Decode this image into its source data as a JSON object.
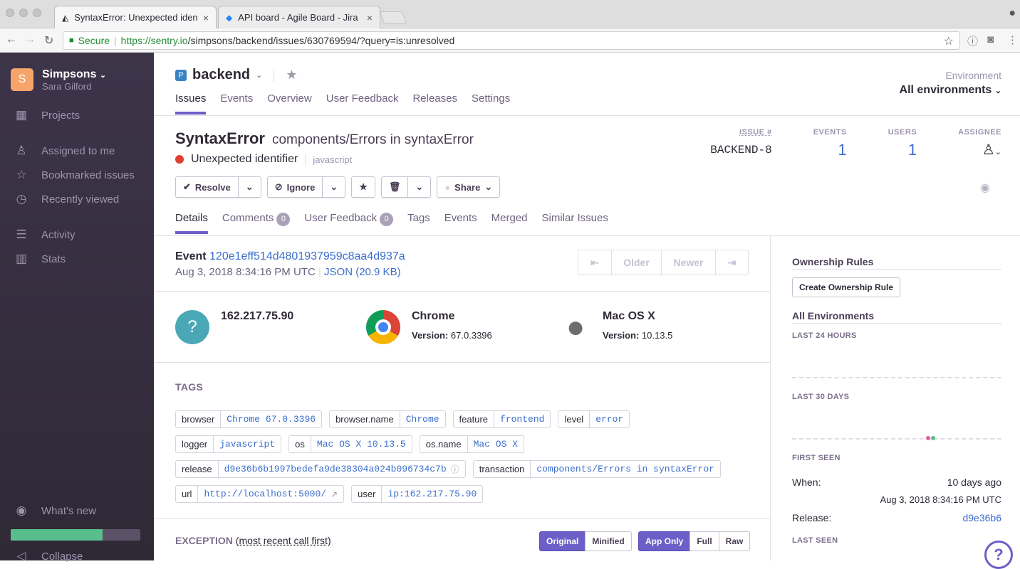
{
  "browser": {
    "tabs": [
      {
        "title": "SyntaxError: Unexpected ident"
      },
      {
        "title": "API board - Agile Board - Jira"
      }
    ],
    "secure_label": "Secure",
    "url_host": "https://sentry.io",
    "url_path": "/simpsons/backend/issues/630769594/?query=is:unresolved"
  },
  "sidebar": {
    "org_initial": "S",
    "org_name": "Simpsons",
    "user_name": "Sara Gilford",
    "items": [
      {
        "label": "Projects"
      },
      {
        "label": "Assigned to me"
      },
      {
        "label": "Bookmarked issues"
      },
      {
        "label": "Recently viewed"
      },
      {
        "label": "Activity"
      },
      {
        "label": "Stats"
      }
    ],
    "whats_new": "What's new",
    "collapse": "Collapse",
    "onboarding_progress": 0.71
  },
  "project": {
    "name": "backend",
    "nav": [
      "Issues",
      "Events",
      "Overview",
      "User Feedback",
      "Releases",
      "Settings"
    ],
    "env_label": "Environment",
    "env_value": "All environments"
  },
  "issue": {
    "type": "SyntaxError",
    "location": "components/Errors in syntaxError",
    "message": "Unexpected identifier",
    "platform": "javascript",
    "stats": {
      "issue_label": "ISSUE #",
      "issue_value": "BACKEND-8",
      "events_label": "EVENTS",
      "events_value": "1",
      "users_label": "USERS",
      "users_value": "1",
      "assignee_label": "ASSIGNEE"
    },
    "actions": {
      "resolve": "Resolve",
      "ignore": "Ignore",
      "share": "Share"
    },
    "tabs": [
      {
        "label": "Details"
      },
      {
        "label": "Comments",
        "badge": "0"
      },
      {
        "label": "User Feedback",
        "badge": "0"
      },
      {
        "label": "Tags"
      },
      {
        "label": "Events"
      },
      {
        "label": "Merged"
      },
      {
        "label": "Similar Issues"
      }
    ]
  },
  "event": {
    "label": "Event",
    "id": "120e1eff514d4801937959c8aa4d937a",
    "date": "Aug 3, 2018 8:34:16 PM UTC",
    "json": "JSON (20.9 KB)",
    "pager": {
      "older": "Older",
      "newer": "Newer"
    },
    "contexts": {
      "user": {
        "name": "162.217.75.90"
      },
      "browser": {
        "name": "Chrome",
        "version_label": "Version:",
        "version": "67.0.3396"
      },
      "os": {
        "name": "Mac OS X",
        "version_label": "Version:",
        "version": "10.13.5"
      }
    }
  },
  "tags_title": "TAGS",
  "tags": [
    [
      {
        "k": "browser",
        "v": "Chrome 67.0.3396"
      },
      {
        "k": "browser.name",
        "v": "Chrome"
      },
      {
        "k": "feature",
        "v": "frontend"
      },
      {
        "k": "level",
        "v": "error"
      }
    ],
    [
      {
        "k": "logger",
        "v": "javascript"
      },
      {
        "k": "os",
        "v": "Mac OS X 10.13.5"
      },
      {
        "k": "os.name",
        "v": "Mac OS X"
      }
    ],
    [
      {
        "k": "release",
        "v": "d9e36b6b1997bedefa9de38304a024b096734c7b"
      },
      {
        "k": "transaction",
        "v": "components/Errors in syntaxError"
      }
    ],
    [
      {
        "k": "url",
        "v": "http://localhost:5000/"
      },
      {
        "k": "user",
        "v": "ip:162.217.75.90"
      }
    ]
  ],
  "exception": {
    "title": "EXCEPTION",
    "subtitle": "most recent call first",
    "view_modes": [
      "Original",
      "Minified"
    ],
    "frame_modes": [
      "App Only",
      "Full",
      "Raw"
    ]
  },
  "right_pane": {
    "ownership_title": "Ownership Rules",
    "create_rule": "Create Ownership Rule",
    "all_env": "All Environments",
    "last24": "LAST 24 HOURS",
    "last30": "LAST 30 DAYS",
    "first_seen": "FIRST SEEN",
    "when_label": "When:",
    "when_value": "10 days ago",
    "when_date": "Aug 3, 2018 8:34:16 PM UTC",
    "release_label": "Release:",
    "release_value": "d9e36b6",
    "last_seen": "LAST SEEN"
  },
  "colors": {
    "accent": "#6c5fc7",
    "link": "#3b6ecc",
    "error": "#e03e2f",
    "sidebar": "#2f2936"
  }
}
